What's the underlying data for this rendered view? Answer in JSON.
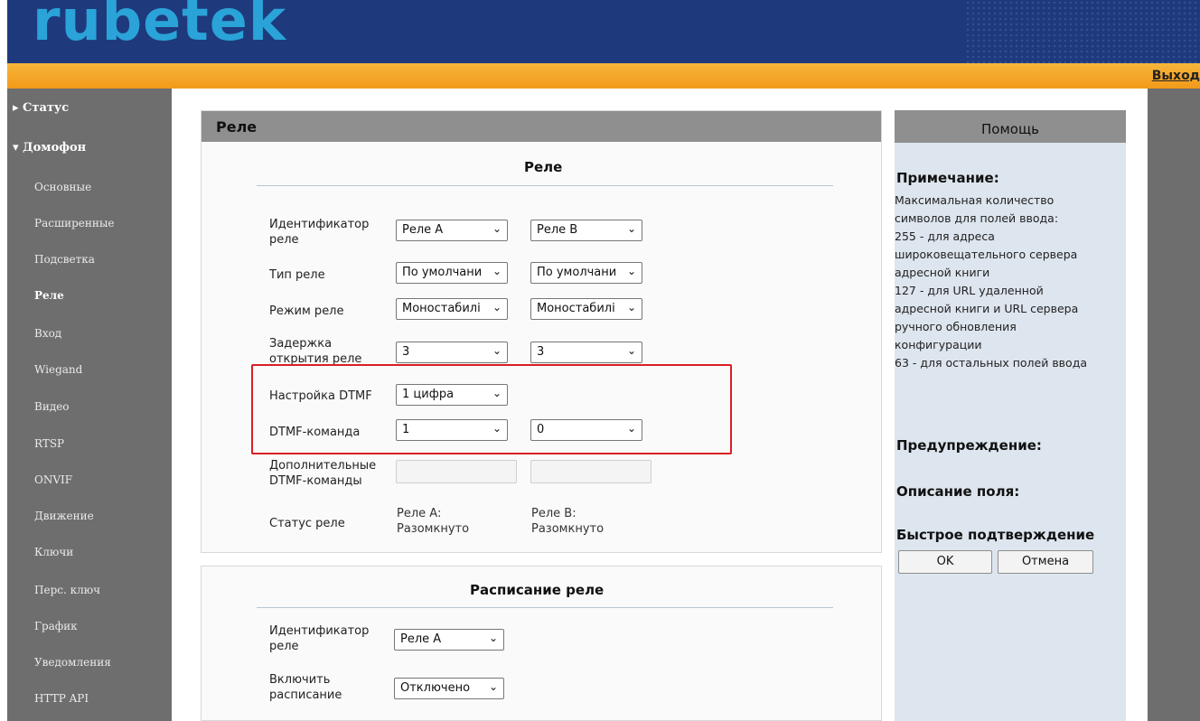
{
  "header": {
    "logo_text": "rubetek",
    "logout_label": "Выход"
  },
  "sidebar": {
    "groups": [
      {
        "label": "▸ Статус"
      },
      {
        "label": "▾ Домофон"
      }
    ],
    "items": [
      {
        "label": "Основные"
      },
      {
        "label": "Расширенные"
      },
      {
        "label": "Подсветка"
      },
      {
        "label": "Реле",
        "active": true
      },
      {
        "label": "Вход"
      },
      {
        "label": "Wiegand"
      },
      {
        "label": "Видео"
      },
      {
        "label": "RTSP"
      },
      {
        "label": "ONVIF"
      },
      {
        "label": "Движение"
      },
      {
        "label": "Ключи"
      },
      {
        "label": "Перс. ключ"
      },
      {
        "label": "График"
      },
      {
        "label": "Уведомления"
      },
      {
        "label": "HTTP API"
      }
    ]
  },
  "relay": {
    "panel_title": "Реле",
    "section_title": "Реле",
    "rows": {
      "id": {
        "label": "Идентификатор реле",
        "a": "Реле A",
        "b": "Реле B"
      },
      "type": {
        "label": "Тип реле",
        "a": "По умолчани",
        "b": "По умолчани"
      },
      "mode": {
        "label": "Режим реле",
        "a": "Моностабилі",
        "b": "Моностабилі"
      },
      "delay": {
        "label": "Задержка открытия реле",
        "a": "3",
        "b": "3"
      },
      "dtmf_setting": {
        "label": "Настройка DTMF",
        "a": "1 цифра"
      },
      "dtmf_command": {
        "label": "DTMF-команда",
        "a": "1",
        "b": "0"
      },
      "extra_dtmf": {
        "label": "Дополнительные DTMF-команды",
        "a": "",
        "b": ""
      },
      "status": {
        "label": "Статус реле",
        "a": "Реле A: Разомкнуто",
        "b": "Реле B: Разомкнуто"
      }
    }
  },
  "schedule": {
    "section_title": "Расписание реле",
    "rows": {
      "id": {
        "label": "Идентификатор реле",
        "value": "Реле A"
      },
      "enable": {
        "label": "Включить расписание",
        "value": "Отключено"
      }
    }
  },
  "help": {
    "title": "Помощь",
    "note_heading": "Примечание:",
    "note_lines": [
      "Максимальная количество",
      "символов для полей ввода:",
      "255 - для адреса",
      "широковещательного сервера",
      "адресной книги",
      "127 - для URL удаленной",
      "адресной книги и URL сервера",
      "ручного обновления",
      "конфигурации",
      "63 - для остальных полей ввода"
    ],
    "warning_heading": "Предупреждение:",
    "field_desc_heading": "Описание поля:",
    "quick_confirm_heading": "Быстрое подтверждение",
    "ok_label": "OK",
    "cancel_label": "Отмена"
  },
  "icons": {
    "select_arrow": "chevron-down-icon"
  },
  "colors": {
    "header_blue": "#1e3a7c",
    "logo_cyan": "#2aa3d8",
    "orange_bar": "#f29a1a",
    "sidebar_gray": "#6e6e6e",
    "highlight_red": "#d81f26"
  }
}
